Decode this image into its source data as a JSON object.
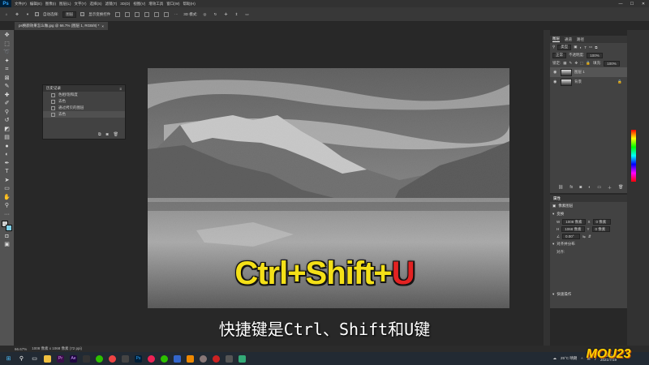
{
  "app": {
    "logo": "Ps"
  },
  "menu": {
    "items": [
      "文件(F)",
      "编辑(E)",
      "图像(I)",
      "图层(L)",
      "文字(Y)",
      "选择(S)",
      "滤镜(T)",
      "3D(D)",
      "视图(V)",
      "增效工具",
      "窗口(W)",
      "帮助(H)"
    ]
  },
  "window_controls": {
    "minimize": "—",
    "maximize": "☐",
    "close": "✕"
  },
  "options": {
    "auto_select_label": "自动选择:",
    "auto_select_value": "图层",
    "show_transform_label": "显示变换控件",
    "mode_3d_label": "3D 模式:"
  },
  "document_tab": {
    "title": "ps换颜效果怎么做.jpg @ 66.7% (图层 1, RGB/8) *",
    "close": "×"
  },
  "history": {
    "title": "历史记录",
    "items": [
      "色相/饱和度",
      "去色",
      "通过拷贝的图层",
      "去色"
    ],
    "selected": 3
  },
  "layers": {
    "tabs": [
      "图层",
      "通道",
      "路径"
    ],
    "filter_label": "类型",
    "blend_mode": "正常",
    "opacity_label": "不透明度:",
    "opacity_value": "100%",
    "lock_label": "锁定:",
    "fill_label": "填充:",
    "fill_value": "100%",
    "items": [
      {
        "name": "图层 1",
        "selected": true
      },
      {
        "name": "背景",
        "locked": true
      }
    ]
  },
  "properties": {
    "tab": "属性",
    "kind": "像素图层",
    "transform_label": "变换",
    "w_label": "W",
    "w_value": "1008 像素",
    "h_label": "H",
    "h_value": "1068 像素",
    "x_label": "X",
    "x_value": "0 像素",
    "y_label": "Y",
    "y_value": "0 像素",
    "angle_value": "0.00°",
    "align_label": "对齐并分布",
    "align_sub": "对齐:",
    "quick_actions": "快速操作"
  },
  "status": {
    "zoom": "66.67%",
    "doc_info": "1008 像素 x 1068 像素 (72 ppi)"
  },
  "taskbar": {
    "tray_temp": "25°C 晴朗",
    "tray_time": "15:55",
    "tray_date": "2021/7/19"
  },
  "overlay": {
    "shortcut_prefix": "Ctrl+Shift+",
    "shortcut_key": "U",
    "subtitle": "快捷键是Ctrl、Shift和U键"
  },
  "watermark": {
    "text": "MOU23"
  }
}
